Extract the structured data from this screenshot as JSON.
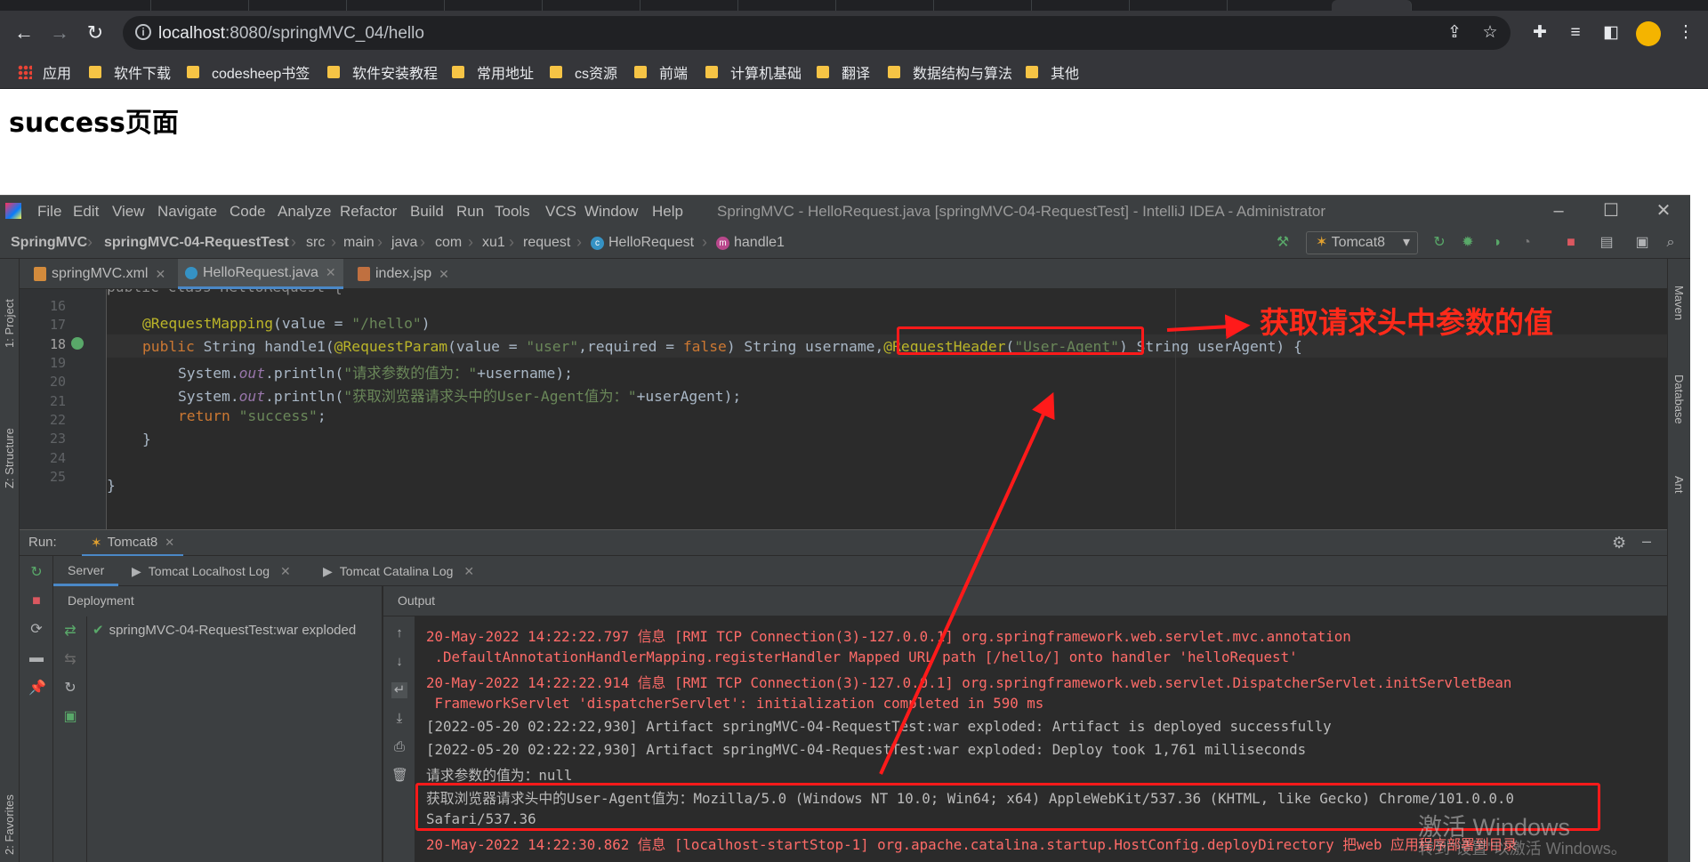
{
  "browser": {
    "url_host": "localhost",
    "url_rest": ":8080/springMVC_04/hello",
    "bookmarks": [
      "应用",
      "软件下载",
      "codesheep书签",
      "软件安装教程",
      "常用地址",
      "cs资源",
      "前端",
      "计算机基础",
      "翻译",
      "数据结构与算法",
      "其他"
    ]
  },
  "page": {
    "title": "success页面"
  },
  "ide": {
    "menu": [
      "File",
      "Edit",
      "View",
      "Navigate",
      "Code",
      "Analyze",
      "Refactor",
      "Build",
      "Run",
      "Tools",
      "VCS",
      "Window",
      "Help"
    ],
    "window_title": "SpringMVC - HelloRequest.java [springMVC-04-RequestTest] - IntelliJ IDEA - Administrator",
    "breadcrumbs": [
      "SpringMVC",
      "springMVC-04-RequestTest",
      "src",
      "main",
      "java",
      "com",
      "xu1",
      "request",
      "HelloRequest",
      "handle1"
    ],
    "run_config": "Tomcat8",
    "tabs": [
      "springMVC.xml",
      "HelloRequest.java",
      "index.jsp"
    ],
    "left_stripe": [
      "1: Project",
      "Z: Structure",
      "2: Favorites"
    ],
    "right_stripe": [
      "Maven",
      "Database",
      "Ant"
    ],
    "line_numbers": [
      "16",
      "17",
      "18",
      "19",
      "20",
      "21",
      "22",
      "23",
      "24",
      "25"
    ],
    "code": {
      "l15": "public class HelloRequest {",
      "l17_ann": "@RequestMapping",
      "l17_rest_a": "(value = ",
      "l17_str": "\"/hello\"",
      "l17_rest_b": ")",
      "l18_kw": "public ",
      "l18_a": "String handle1(",
      "l18_ann1": "@RequestParam",
      "l18_b": "(value = ",
      "l18_str1": "\"user\"",
      "l18_c": ",required = ",
      "l18_kw2": "false",
      "l18_d": ") String username,",
      "l18_ann2": "@RequestHeader",
      "l18_e": "(",
      "l18_str2": "\"User-Agent\"",
      "l18_f": ") String userAgent) {",
      "l19_a": "System.",
      "l19_out": "out",
      "l19_b": ".println(",
      "l19_str": "\"请求参数的值为：\"",
      "l19_c": "+username);",
      "l20_a": "System.",
      "l20_out": "out",
      "l20_b": ".println(",
      "l20_str": "\"获取浏览器请求头中的User-Agent值为：\"",
      "l20_c": "+userAgent);",
      "l21_kw": "return ",
      "l21_str": "\"success\"",
      "l21_c": ";",
      "l22": "}",
      "l24": "}"
    },
    "run": {
      "label": "Run:",
      "config_tab": "Tomcat8",
      "service_tabs": [
        "Server",
        "Tomcat Localhost Log",
        "Tomcat Catalina Log"
      ],
      "deployment_header": "Deployment",
      "output_header": "Output",
      "artifact": "springMVC-04-RequestTest:war exploded"
    },
    "console": [
      {
        "style": "red",
        "text": "20-May-2022 14:22:22.797 信息 [RMI TCP Connection(3)-127.0.0.1] org.springframework.web.servlet.mvc.annotation"
      },
      {
        "style": "red",
        "text": " .DefaultAnnotationHandlerMapping.registerHandler Mapped URL path [/hello/] onto handler 'helloRequest'"
      },
      {
        "style": "red",
        "text": "20-May-2022 14:22:22.914 信息 [RMI TCP Connection(3)-127.0.0.1] org.springframework.web.servlet.DispatcherServlet.initServletBean"
      },
      {
        "style": "red",
        "text": " FrameworkServlet 'dispatcherServlet': initialization completed in 590 ms"
      },
      {
        "style": "gray",
        "text": "[2022-05-20 02:22:22,930] Artifact springMVC-04-RequestTest:war exploded: Artifact is deployed successfully"
      },
      {
        "style": "gray",
        "text": "[2022-05-20 02:22:22,930] Artifact springMVC-04-RequestTest:war exploded: Deploy took 1,761 milliseconds"
      },
      {
        "style": "gray",
        "text": "请求参数的值为：null"
      },
      {
        "style": "gray",
        "text": "获取浏览器请求头中的User-Agent值为：Mozilla/5.0 (Windows NT 10.0; Win64; x64) AppleWebKit/537.36 (KHTML, like Gecko) Chrome/101.0.0.0"
      },
      {
        "style": "gray",
        "text": "Safari/537.36"
      },
      {
        "style": "red",
        "text": "20-May-2022 14:22:30.862 信息 [localhost-startStop-1] org.apache.catalina.startup.HostConfig.deployDirectory 把web 应用程序部署到目录"
      }
    ]
  },
  "annotation": {
    "text": "获取请求头中参数的值",
    "color": "#ff1a1a"
  },
  "watermark": {
    "line1": "激活 Windows",
    "line2": "转到\"设置\"以激活 Windows。"
  },
  "colors": {
    "ide_bg": "#2b2b2b",
    "keyword": "#cc7832",
    "annotation": "#bbb529",
    "string": "#6a8759",
    "console_red": "#ff6b68"
  }
}
